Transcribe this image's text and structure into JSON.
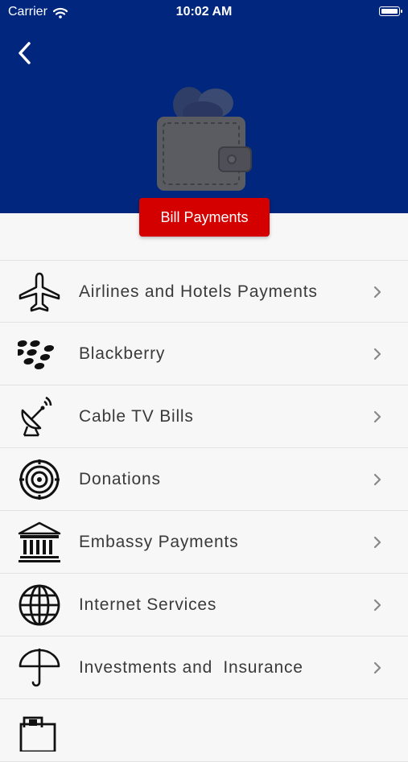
{
  "status_bar": {
    "carrier": "Carrier",
    "time": "10:02 AM"
  },
  "header": {
    "title": "Bill Payments",
    "bg_color": "#01267d",
    "accent_color": "#d40000"
  },
  "list": [
    {
      "label": "Airlines and Hotels Payments",
      "icon": "airplane-icon"
    },
    {
      "label": "Blackberry",
      "icon": "blackberry-icon"
    },
    {
      "label": "Cable TV Bills",
      "icon": "satellite-dish-icon"
    },
    {
      "label": "Donations",
      "icon": "target-icon"
    },
    {
      "label": "Embassy Payments",
      "icon": "bank-building-icon"
    },
    {
      "label": "Internet Services",
      "icon": "globe-icon"
    },
    {
      "label": "Investments and  Insurance",
      "icon": "umbrella-icon"
    },
    {
      "label": "",
      "icon": "bill-icon"
    }
  ]
}
